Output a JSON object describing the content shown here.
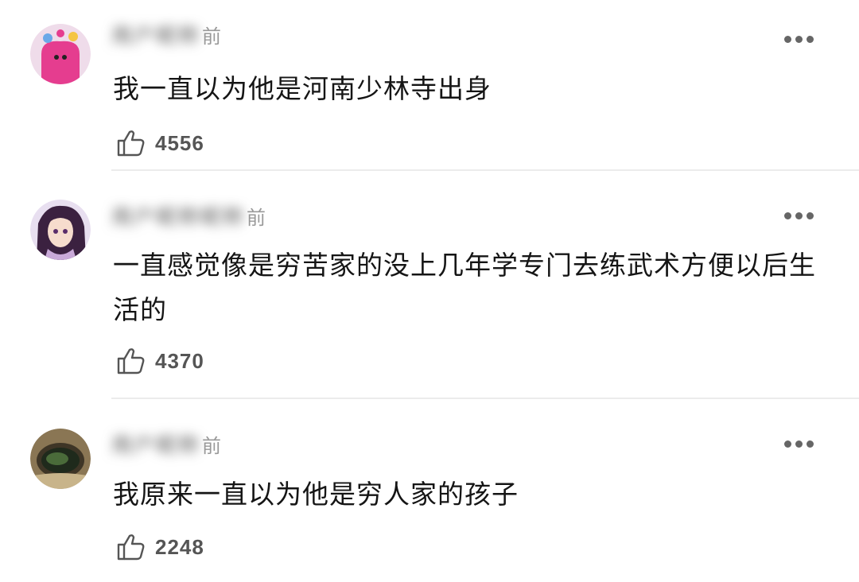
{
  "comments": [
    {
      "username": "用户昵称",
      "time": "前",
      "text": "我一直以为他是河南少林寺出身",
      "likes": "4556",
      "avatar_color": "#e83c8f"
    },
    {
      "username": "用户昵称昵称",
      "time": "前",
      "text": "一直感觉像是穷苦家的没上几年学专门去练武术方便以后生活的",
      "likes": "4370",
      "avatar_color": "#b7a9d6"
    },
    {
      "username": "用户昵称",
      "time": "前",
      "text": "我原来一直以为他是穷人家的孩子",
      "likes": "2248",
      "avatar_color": "#6b5b3e"
    }
  ],
  "icons": {
    "like": "thumbs-up-icon",
    "more": "more-dots-icon"
  }
}
